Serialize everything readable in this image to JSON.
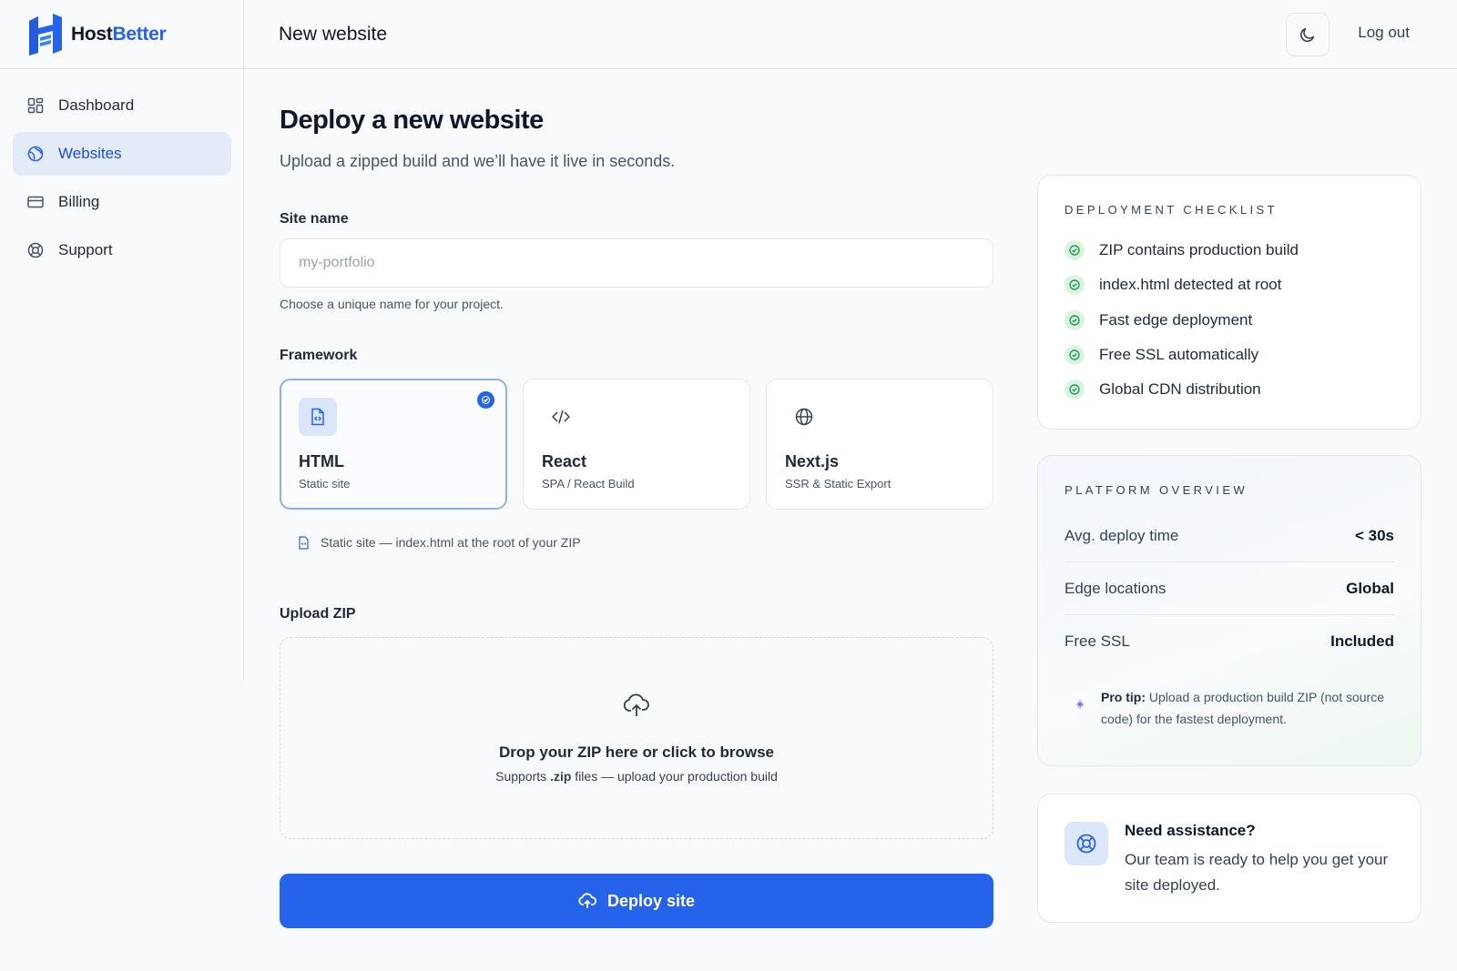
{
  "brand": {
    "name_part1": "Host",
    "name_part2": "Better"
  },
  "sidebar": {
    "items": [
      {
        "label": "Dashboard",
        "icon": "dashboard-icon"
      },
      {
        "label": "Websites",
        "icon": "globe-icon",
        "active": true
      },
      {
        "label": "Billing",
        "icon": "credit-card-icon"
      },
      {
        "label": "Support",
        "icon": "lifebuoy-icon"
      }
    ]
  },
  "header": {
    "title": "New website",
    "theme_icon": "moon-icon",
    "logout_label": "Log out"
  },
  "main": {
    "title": "Deploy a new website",
    "subtitle": "Upload a zipped build and we’ll have it live in seconds.",
    "site_name": {
      "label": "Site name",
      "placeholder": "my-portfolio",
      "value": "",
      "hint": "Choose a unique name for your project."
    },
    "framework": {
      "label": "Framework",
      "options": [
        {
          "name": "HTML",
          "desc": "Static site",
          "icon": "file-code-icon",
          "selected": true
        },
        {
          "name": "React",
          "desc": "SPA / React Build",
          "icon": "code-icon",
          "selected": false
        },
        {
          "name": "Next.js",
          "desc": "SSR & Static Export",
          "icon": "globe-icon",
          "selected": false
        }
      ],
      "note": "Static site — index.html at the root of your ZIP"
    },
    "upload": {
      "label": "Upload ZIP",
      "title": "Drop your ZIP here or click to browse",
      "sub_prefix": "Supports ",
      "sub_ext": ".zip",
      "sub_suffix": " files — upload your production build"
    },
    "deploy_label": "Deploy site"
  },
  "checklist": {
    "title": "DEPLOYMENT CHECKLIST",
    "items": [
      "ZIP contains production build",
      "index.html detected at root",
      "Fast edge deployment",
      "Free SSL automatically",
      "Global CDN distribution"
    ]
  },
  "overview": {
    "title": "PLATFORM OVERVIEW",
    "rows": [
      {
        "key": "Avg. deploy time",
        "value": "< 30s"
      },
      {
        "key": "Edge locations",
        "value": "Global"
      },
      {
        "key": "Free SSL",
        "value": "Included"
      }
    ],
    "tip_label": "Pro tip:",
    "tip_text": " Upload a production build ZIP (not source code) for the fastest deployment."
  },
  "help": {
    "title": "Need assistance?",
    "text": "Our team is ready to help you get your site deployed."
  },
  "colors": {
    "accent": "#2563eb",
    "success": "#16a34a",
    "active_nav_bg": "#e3ebf9"
  }
}
